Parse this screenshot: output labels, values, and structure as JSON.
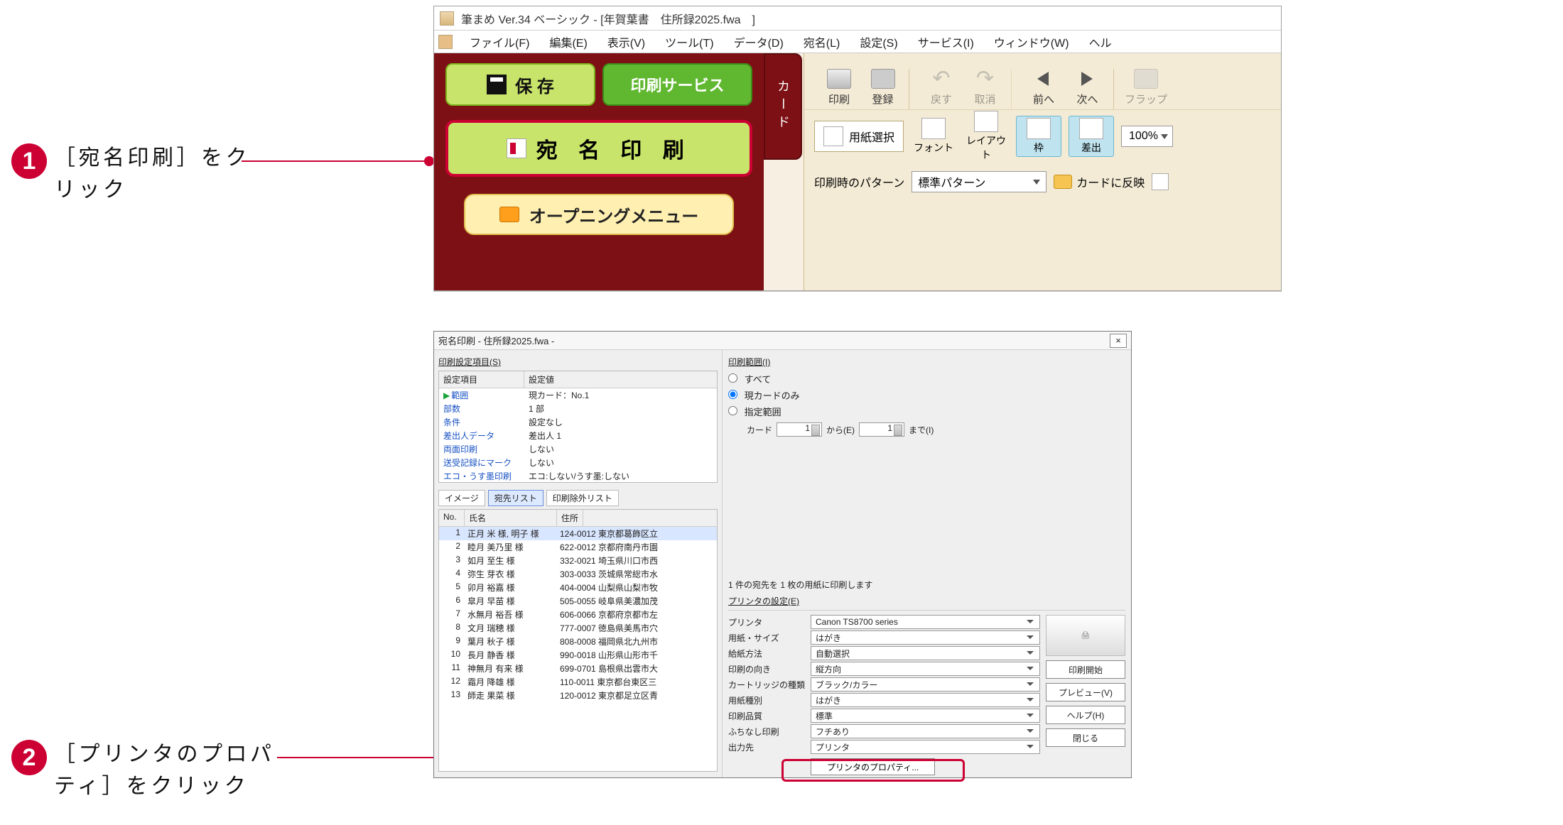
{
  "callouts": {
    "one": {
      "num": "1",
      "text_a": "［宛名印刷］をク",
      "text_b": "リック"
    },
    "two": {
      "num": "2",
      "text_a": "［プリンタのプロパ",
      "text_b": "ティ］をクリック"
    }
  },
  "app": {
    "title": "筆まめ Ver.34 ベーシック - [年賀葉書　住所録2025.fwa　]",
    "menus": [
      "ファイル(F)",
      "編集(E)",
      "表示(V)",
      "ツール(T)",
      "データ(D)",
      "宛名(L)",
      "設定(S)",
      "サービス(I)",
      "ウィンドウ(W)",
      "ヘル"
    ],
    "big_buttons": {
      "save": "保 存",
      "print_service": "印刷サービス",
      "addr_print": "宛 名 印 刷",
      "opening_menu": "オープニングメニュー"
    },
    "side_tab": "カード",
    "ribbon_row1": {
      "print": "印刷",
      "register": "登録",
      "undo": "戻す",
      "redo": "取消",
      "prev": "前へ",
      "next": "次へ",
      "flap": "フラップ"
    },
    "ribbon_row2": {
      "paper_select": "用紙選択",
      "font": "フォント",
      "layout": "レイアウト",
      "frame": "枠",
      "deliver": "差出",
      "zoom": "100%"
    },
    "ribbon_row3": {
      "label": "印刷時のパターン",
      "value": "標準パターン",
      "reflect": "カードに反映"
    }
  },
  "dialog": {
    "title": "宛名印刷 - 住所録2025.fwa -",
    "settings_group": "印刷設定項目(S)",
    "settings_header": {
      "c1": "設定項目",
      "c2": "設定値"
    },
    "settings_rows": [
      {
        "c1": "範囲",
        "c2": "現カード：No.1",
        "sel": true
      },
      {
        "c1": "部数",
        "c2": "1 部"
      },
      {
        "c1": "条件",
        "c2": "設定なし"
      },
      {
        "c1": "差出人データ",
        "c2": "差出人 1"
      },
      {
        "c1": "両面印刷",
        "c2": "しない"
      },
      {
        "c1": "送受記録にマーク",
        "c2": "しない"
      },
      {
        "c1": "エコ・うす墨印刷",
        "c2": "エコ:しない/うす墨:しない"
      }
    ],
    "tabs": {
      "image": "イメージ",
      "list": "宛先リスト",
      "exclude": "印刷除外リスト"
    },
    "addr_header": {
      "n": "No.",
      "nm": "氏名",
      "ad": "住所"
    },
    "addr_rows": [
      {
        "n": "1",
        "nm": "正月 米 様, 明子 様",
        "ad": "124-0012 東京都葛飾区立",
        "hi": true
      },
      {
        "n": "2",
        "nm": "睦月 美乃里 様",
        "ad": "622-0012 京都府南丹市園"
      },
      {
        "n": "3",
        "nm": "如月 至生 様",
        "ad": "332-0021 埼玉県川口市西"
      },
      {
        "n": "4",
        "nm": "弥生 芽衣 様",
        "ad": "303-0033 茨城県常総市水"
      },
      {
        "n": "5",
        "nm": "卯月 裕嘉 様",
        "ad": "404-0004 山梨県山梨市牧"
      },
      {
        "n": "6",
        "nm": "皐月 早苗 様",
        "ad": "505-0055 岐阜県美濃加茂"
      },
      {
        "n": "7",
        "nm": "水無月 裕吾 様",
        "ad": "606-0066 京都府京都市左"
      },
      {
        "n": "8",
        "nm": "文月 瑞穂 様",
        "ad": "777-0007 徳島県美馬市穴"
      },
      {
        "n": "9",
        "nm": "葉月 秋子 様",
        "ad": "808-0008 福岡県北九州市"
      },
      {
        "n": "10",
        "nm": "長月 静香 様",
        "ad": "990-0018 山形県山形市千"
      },
      {
        "n": "11",
        "nm": "神無月 有来 様",
        "ad": "699-0701 島根県出雲市大"
      },
      {
        "n": "12",
        "nm": "霜月 降雄 様",
        "ad": "110-0011 東京都台東区三"
      },
      {
        "n": "13",
        "nm": "師走 果菜 様",
        "ad": "120-0012 東京都足立区青"
      }
    ],
    "range": {
      "group": "印刷範囲(I)",
      "all": "すべて",
      "current": "現カードのみ",
      "spec": "指定範囲",
      "card": "カード",
      "from": "から(E)",
      "to": "まで(I)",
      "val_from": "1",
      "val_to": "1"
    },
    "status": "1 件の宛先を 1 枚の用紙に印刷します",
    "printer": {
      "group": "プリンタの設定(E)",
      "rows": [
        {
          "l": "プリンタ",
          "v": "Canon TS8700 series"
        },
        {
          "l": "用紙・サイズ",
          "v": "はがき"
        },
        {
          "l": "給紙方法",
          "v": "自動選択"
        },
        {
          "l": "印刷の向き",
          "v": "縦方向"
        },
        {
          "l": "カートリッジの種類",
          "v": "ブラック/カラー"
        },
        {
          "l": "用紙種別",
          "v": "はがき"
        },
        {
          "l": "印刷品質",
          "v": "標準"
        },
        {
          "l": "ふちなし印刷",
          "v": "フチあり"
        },
        {
          "l": "出力先",
          "v": "プリンタ"
        }
      ],
      "prop_btn": "プリンタのプロパティ..."
    },
    "buttons": {
      "start": "印刷開始",
      "preview": "プレビュー(V)",
      "help": "ヘルプ(H)",
      "close": "閉じる"
    }
  }
}
